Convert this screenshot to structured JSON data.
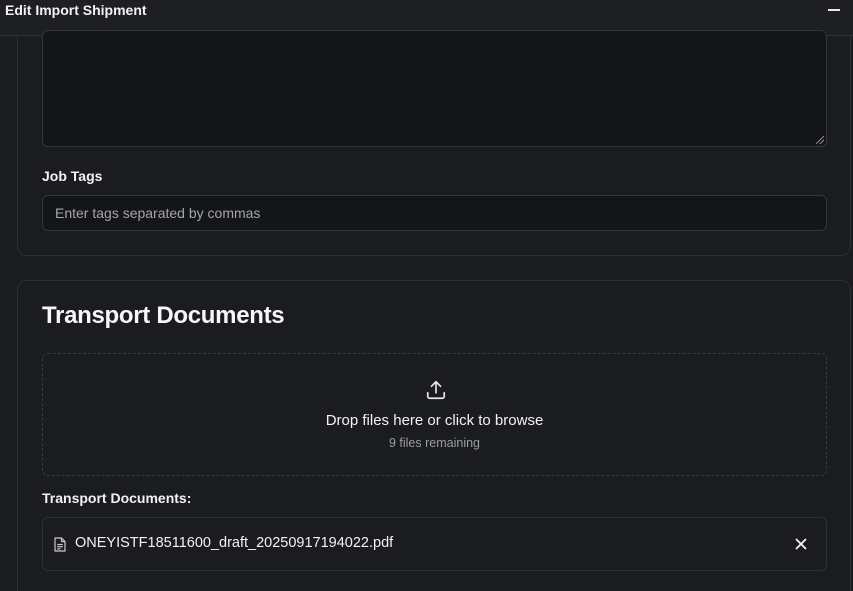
{
  "window": {
    "title": "Edit Import Shipment",
    "minimize_icon": "minus-icon"
  },
  "notes": {
    "value": ""
  },
  "job_tags": {
    "label": "Job Tags",
    "placeholder": "Enter tags separated by commas",
    "value": ""
  },
  "transport_documents": {
    "title": "Transport Documents",
    "dropzone": {
      "icon": "upload-icon",
      "text": "Drop files here or click to browse",
      "remaining": "9 files remaining"
    },
    "list_label": "Transport Documents:",
    "files": [
      {
        "name": "ONEYISTF18511600_draft_20250917194022.pdf",
        "icon": "file-icon",
        "remove_icon": "close-icon"
      }
    ]
  },
  "colors": {
    "background": "#1b1c20",
    "input_background": "#141518",
    "border": "#2e2f35",
    "text": "#f2f2f3",
    "muted_text": "#9c9da3"
  }
}
